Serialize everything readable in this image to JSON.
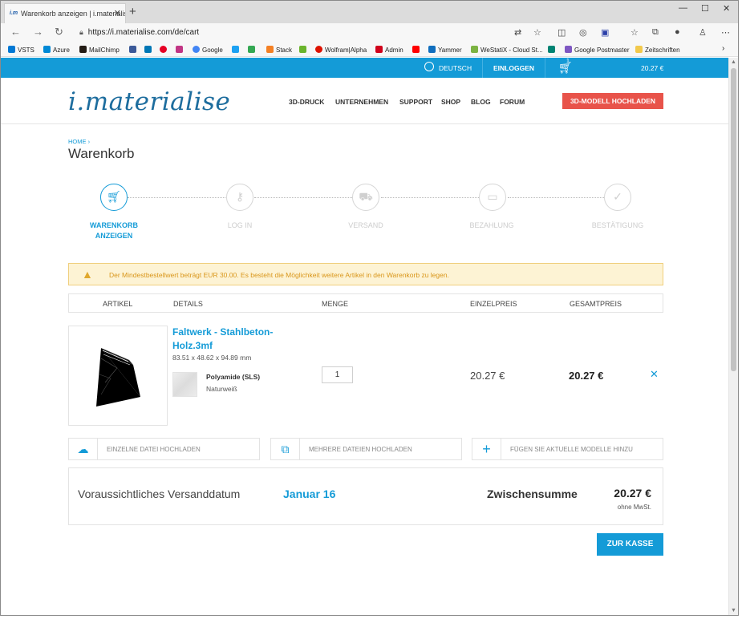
{
  "browser": {
    "tab_title": "Warenkorb anzeigen | i.materialise",
    "tab_favicon": "i.m",
    "url": "https://i.materialise.com/de/cart",
    "favorites": [
      {
        "label": "VSTS",
        "color": "#0078d4"
      },
      {
        "label": "Azure",
        "color": "#0089d6"
      },
      {
        "label": "MailChimp",
        "color": "#241c15"
      },
      {
        "label": "",
        "color": "#3b5998"
      },
      {
        "label": "",
        "color": "#0077b5"
      },
      {
        "label": "",
        "color": "#e60023"
      },
      {
        "label": "",
        "color": "#c13584"
      },
      {
        "label": "Google",
        "color": "#4285f4"
      },
      {
        "label": "",
        "color": "#1da1f2"
      },
      {
        "label": "",
        "color": "#34a853"
      },
      {
        "label": "Stack",
        "color": "#f48024"
      },
      {
        "label": "",
        "color": "#6ab42d"
      },
      {
        "label": "Wolfram|Alpha",
        "color": "#dd1100"
      },
      {
        "label": "Admin",
        "color": "#d0021b"
      },
      {
        "label": "",
        "color": "#ff0000"
      },
      {
        "label": "Yammer",
        "color": "#106ebe"
      },
      {
        "label": "WeStatiX - Cloud St...",
        "color": "#7cb342"
      },
      {
        "label": "",
        "color": "#008373"
      },
      {
        "label": "Google Postmaster",
        "color": "#7e57c2"
      },
      {
        "label": "Zeitschriften",
        "color": "#f2c94c"
      }
    ]
  },
  "topbar": {
    "language": "DEUTSCH",
    "login": "EINLOGGEN",
    "cart_count": "1",
    "cart_total": "20.27 €"
  },
  "header": {
    "logo": "i.materialise",
    "menu": [
      "3D-DRUCK",
      "UNTERNEHMEN",
      "SUPPORT",
      "SHOP",
      "BLOG",
      "FORUM"
    ],
    "upload_cta": "3D-MODELL HOCHLADEN"
  },
  "breadcrumb": "HOME ›",
  "page_title": "Warenkorb",
  "steps": [
    {
      "label_line1": "WARENKORB",
      "label_line2": "ANZEIGEN",
      "icon": "cart-icon",
      "active": true
    },
    {
      "label_line1": "LOG IN",
      "label_line2": "",
      "icon": "key-icon",
      "active": false
    },
    {
      "label_line1": "VERSAND",
      "label_line2": "",
      "icon": "truck-icon",
      "active": false
    },
    {
      "label_line1": "BEZAHLUNG",
      "label_line2": "",
      "icon": "credit-card-icon",
      "active": false
    },
    {
      "label_line1": "BESTÄTIGUNG",
      "label_line2": "",
      "icon": "check-icon",
      "active": false
    }
  ],
  "warning": "Der Mindestbestellwert beträgt EUR 30.00. Es besteht die Möglichkeit weitere Artikel in den Warenkorb zu legen.",
  "table_headers": {
    "article": "ARTIKEL",
    "details": "DETAILS",
    "quantity": "MENGE",
    "unit_price": "EINZELPREIS",
    "total_price": "GESAMTPREIS"
  },
  "item": {
    "name": "Faltwerk - Stahlbeton-Holz.3mf",
    "dimensions": "83.51 x 48.62 x 94.89 mm",
    "material": "Polyamide (SLS)",
    "finish": "Naturweiß",
    "quantity": "1",
    "unit_price": "20.27 €",
    "total_price": "20.27 €",
    "remove": "✕"
  },
  "upload_buttons": [
    {
      "label": "EINZELNE DATEI HOCHLADEN",
      "icon": "cloud-upload-icon"
    },
    {
      "label": "MEHRERE DATEIEN HOCHLADEN",
      "icon": "copy-icon"
    },
    {
      "label": "FÜGEN SIE AKTUELLE MODELLE HINZU",
      "icon": "plus-icon"
    }
  ],
  "summary": {
    "shipping_label": "Voraussichtliches Versanddatum",
    "shipping_date": "Januar 16",
    "subtotal_label": "Zwischensumme",
    "subtotal_value": "20.27 €",
    "subtotal_note": "ohne MwSt."
  },
  "checkout": "ZUR KASSE",
  "colors": {
    "accent": "#149bd7",
    "cta": "#e8534a",
    "warning_bg": "#fdf3d4",
    "warning_text": "#d9961a"
  }
}
